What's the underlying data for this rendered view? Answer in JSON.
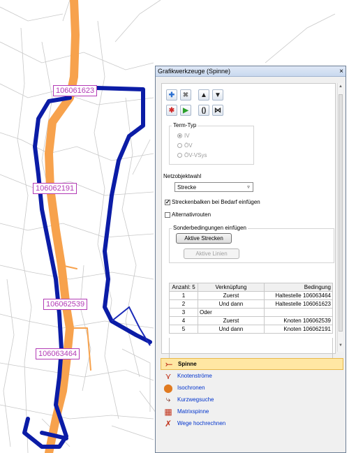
{
  "colors": {
    "route_orange": "#f7a24d",
    "route_blue": "#0b1ca6",
    "node_label": "#b23ab5",
    "active_tab": "#ffe7a3"
  },
  "map": {
    "node_labels": [
      "106061623",
      "106062191",
      "106062539",
      "106063464"
    ]
  },
  "panel": {
    "title": "Grafikwerkzeuge (Spinne)",
    "close_icon": "×",
    "toolbar_icons": [
      "add-icon",
      "delete-icon",
      "move-up-icon",
      "move-down-icon",
      "marker-icon",
      "run-icon",
      "brackets-icon",
      "brackets-cross-icon"
    ],
    "term_typ": {
      "title": "Term-Typ",
      "options": [
        "IV",
        "ÖV",
        "ÖV-VSys"
      ],
      "selected": "IV"
    },
    "netzobjektwahl": {
      "label": "Netzobjektwahl",
      "value": "Strecke"
    },
    "checkboxes": [
      {
        "label": "Streckenbalken bei Bedarf einfügen",
        "checked": true
      },
      {
        "label": "Alternativrouten",
        "checked": false
      }
    ],
    "sonder": {
      "title": "Sonderbedingungen einfügen",
      "btn_strecken": "Aktive Strecken",
      "btn_linien": "Aktive Linien"
    },
    "grid": {
      "headers": [
        "Anzahl: 5",
        "Verknüpfung",
        "Bedingung"
      ],
      "rows": [
        [
          "1",
          "Zuerst",
          "Haltestelle 106063464"
        ],
        [
          "2",
          "Und dann",
          "Haltestelle 106061623"
        ],
        [
          "3",
          "Oder",
          ""
        ],
        [
          "4",
          "Zuerst",
          "Knoten 106062539"
        ],
        [
          "5",
          "Und dann",
          "Knoten 106062191"
        ]
      ]
    },
    "tabs": [
      {
        "label": "Spinne",
        "icon": "spider-icon",
        "active": true
      },
      {
        "label": "Knotenströme",
        "icon": "node-flows-icon",
        "active": false
      },
      {
        "label": "Isochronen",
        "icon": "isochrones-icon",
        "active": false
      },
      {
        "label": "Kurzwegsuche",
        "icon": "shortest-path-icon",
        "active": false
      },
      {
        "label": "Matrixspinne",
        "icon": "matrix-spider-icon",
        "active": false
      },
      {
        "label": "Wege hochrechnen",
        "icon": "paths-extrapolate-icon",
        "active": false
      }
    ]
  }
}
